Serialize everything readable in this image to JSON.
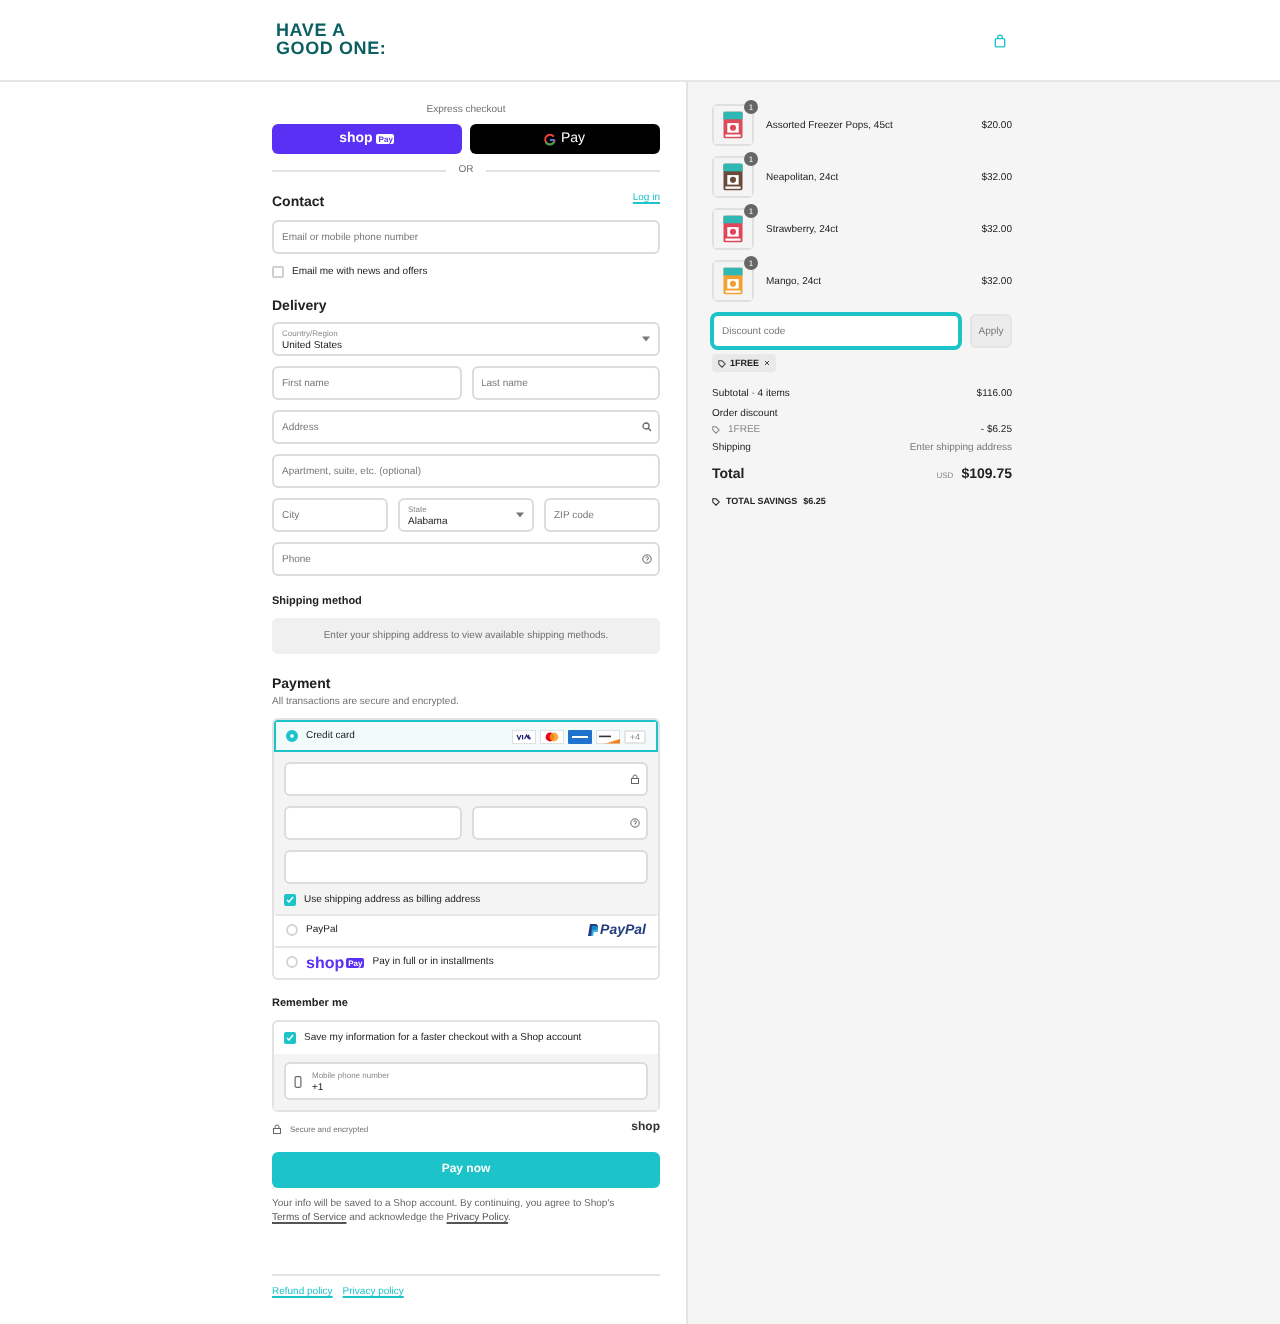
{
  "header": {
    "logo_lines": [
      "HAVE A",
      "GOOD ONE:"
    ]
  },
  "express": {
    "title": "Express checkout",
    "buttons": [
      {
        "kind": "shop_pay",
        "label": "shop",
        "badge": "Pay"
      },
      {
        "kind": "google_pay",
        "label": "Pay"
      }
    ],
    "divider": "OR"
  },
  "contact": {
    "title": "Contact",
    "login_link": "Log in",
    "email": {
      "placeholder": "Email or mobile phone number"
    },
    "newsletter": {
      "label": "Email me with news and offers",
      "checked": false
    }
  },
  "delivery": {
    "title": "Delivery",
    "rows": [
      [
        {
          "kind": "select",
          "label": "Country/Region",
          "value": "United States"
        }
      ],
      [
        {
          "kind": "input",
          "placeholder": "First name"
        },
        {
          "kind": "input",
          "placeholder": "Last name"
        }
      ],
      [
        {
          "kind": "input",
          "placeholder": "Address"
        }
      ],
      [
        {
          "kind": "input",
          "placeholder": "Apartment, suite, etc. (optional)"
        }
      ],
      [
        {
          "kind": "input",
          "placeholder": "City"
        },
        {
          "kind": "select",
          "label": "State",
          "value": "Alabama"
        },
        {
          "kind": "input",
          "placeholder": "ZIP code"
        }
      ],
      [
        {
          "kind": "input",
          "placeholder": "Phone"
        }
      ]
    ]
  },
  "shipping": {
    "title": "Shipping method",
    "notice": "Enter your shipping address to view available shipping methods."
  },
  "payment": {
    "title": "Payment",
    "subtitle": "All transactions are secure and encrypted.",
    "card": {
      "label": "Credit card",
      "selected": true,
      "brands": [
        {
          "kind": "visa"
        },
        {
          "kind": "mastercard"
        },
        {
          "kind": "amex"
        },
        {
          "kind": "discover"
        }
      ],
      "more": "+4",
      "fields": [
        [
          {
            "kind": "input"
          }
        ],
        [
          {
            "kind": "input"
          },
          {
            "kind": "input"
          }
        ],
        [
          {
            "kind": "input"
          }
        ]
      ],
      "billing": {
        "label": "Use shipping address as billing address",
        "checked": true
      }
    },
    "others": [
      {
        "kind": "paypal",
        "label": "PayPal",
        "logo": "PayPal",
        "selected": false
      },
      {
        "kind": "shop_pay",
        "logo": "shop",
        "badge": "Pay",
        "label": "Pay in full or in installments",
        "selected": false
      }
    ]
  },
  "remember": {
    "title": "Remember me",
    "save": {
      "label": "Save my information for a faster checkout with a Shop account",
      "checked": true
    },
    "phone": {
      "label": "Mobile phone number",
      "value": "+1"
    }
  },
  "secure": {
    "label": "Secure and encrypted",
    "logo": "shop"
  },
  "pay_button": "Pay now",
  "legal": [
    {
      "kind": "text",
      "text": "Your info will be saved to a Shop account. By continuing, you agree to Shop's "
    },
    {
      "kind": "link",
      "text": "Terms of Service"
    },
    {
      "kind": "text",
      "text": " and acknowledge the "
    },
    {
      "kind": "link",
      "text": "Privacy Policy"
    },
    {
      "kind": "text",
      "text": "."
    }
  ],
  "footer_links": [
    "Refund policy",
    "Privacy policy"
  ],
  "summary": {
    "items": [
      {
        "name": "Assorted Freezer Pops, 45ct",
        "quantity": "1",
        "price": "$20.00"
      },
      {
        "name": "Neapolitan, 24ct",
        "quantity": "1",
        "price": "$32.00"
      },
      {
        "name": "Strawberry, 24ct",
        "quantity": "1",
        "price": "$32.00"
      },
      {
        "name": "Mango, 24ct",
        "quantity": "1",
        "price": "$32.00"
      }
    ],
    "discount": {
      "placeholder": "Discount code",
      "button": "Apply"
    },
    "applied_codes": [
      "1FREE"
    ],
    "subtotal": {
      "label": "Subtotal · 4 items",
      "value": "$116.00"
    },
    "order_discount": {
      "label": "Order discount",
      "code": "1FREE",
      "value": "- $6.25"
    },
    "shipping": {
      "label": "Shipping",
      "value": "Enter shipping address"
    },
    "total": {
      "label": "Total",
      "currency": "USD",
      "value": "$109.75"
    },
    "savings": {
      "label": "TOTAL SAVINGS",
      "value": "$6.25"
    }
  }
}
